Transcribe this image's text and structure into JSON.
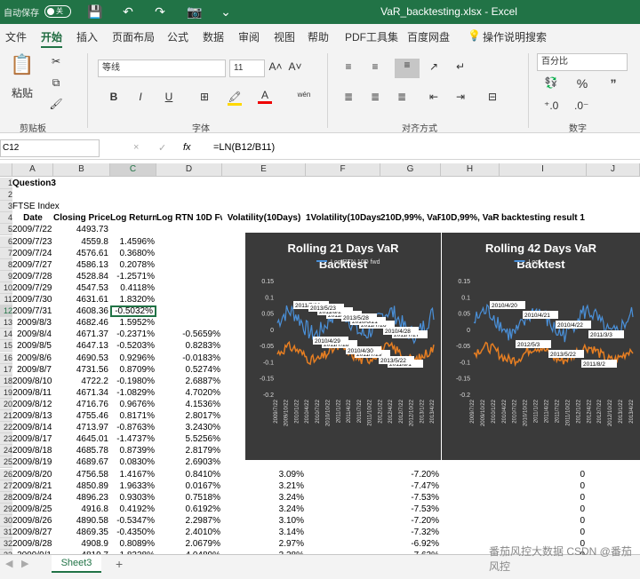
{
  "window": {
    "autosave_label": "自动保存",
    "autosave_state": "关",
    "file_title": "VaR_backtesting.xlsx  -  Excel"
  },
  "menu": [
    "文件",
    "开始",
    "插入",
    "页面布局",
    "公式",
    "数据",
    "审阅",
    "视图",
    "帮助",
    "PDF工具集",
    "百度网盘",
    "操作说明搜索"
  ],
  "ribbon": {
    "paste": "粘贴",
    "clipboard": "剪贴板",
    "font_name": "等线",
    "font_size": "11",
    "font_group": "字体",
    "align_group": "对齐方式",
    "number_format": "百分比",
    "number_group": "数字",
    "bold": "B",
    "italic": "I",
    "underline": "U",
    "font_color": "A",
    "grow_font": "A˄",
    "shrink_font": "A˅",
    "wen": "wén",
    "percent": "%",
    "comma": "”"
  },
  "formula": {
    "name_box": "C12",
    "content": "=LN(B12/B11)",
    "cancel": "×",
    "enter": "✓",
    "fx": "fx"
  },
  "columns": [
    "A",
    "B",
    "C",
    "D",
    "E",
    "F",
    "G",
    "H",
    "I",
    "J"
  ],
  "rows": [
    {
      "n": "1",
      "cells": {
        "A": "Question3"
      }
    },
    {
      "n": "2",
      "cells": {}
    },
    {
      "n": "3",
      "cells": {
        "A": "FTSE Index"
      }
    },
    {
      "n": "4",
      "cells": {
        "A": "Date",
        "B": "Closing Price",
        "C": "Log Return",
        "D": "Log RTN 10D Fwd",
        "E": "Volatility(10Days)",
        "F": "1Volatility(10Days)",
        "G": "210D,99%, VaR1",
        "H": "10D,99%, VaR2",
        "I": "backtesting result 1"
      }
    },
    {
      "n": "5",
      "cells": {
        "A": "2009/7/22",
        "B": "4493.73"
      }
    },
    {
      "n": "6",
      "cells": {
        "A": "2009/7/23",
        "B": "4559.8",
        "C": "1.4596%"
      }
    },
    {
      "n": "7",
      "cells": {
        "A": "2009/7/24",
        "B": "4576.61",
        "C": "0.3680%"
      }
    },
    {
      "n": "8",
      "cells": {
        "A": "2009/7/27",
        "B": "4586.13",
        "C": "0.2078%"
      }
    },
    {
      "n": "9",
      "cells": {
        "A": "2009/7/28",
        "B": "4528.84",
        "C": "-1.2571%"
      }
    },
    {
      "n": "10",
      "cells": {
        "A": "2009/7/29",
        "B": "4547.53",
        "C": "0.4118%"
      }
    },
    {
      "n": "11",
      "cells": {
        "A": "2009/7/30",
        "B": "4631.61",
        "C": "1.8320%"
      }
    },
    {
      "n": "12",
      "cells": {
        "A": "2009/7/31",
        "B": "4608.36",
        "C": "-0.5032%"
      }
    },
    {
      "n": "13",
      "cells": {
        "A": "2009/8/3",
        "B": "4682.46",
        "C": "1.5952%"
      }
    },
    {
      "n": "14",
      "cells": {
        "A": "2009/8/4",
        "B": "4671.37",
        "C": "-0.2371%",
        "D": "-0.5659%"
      }
    },
    {
      "n": "15",
      "cells": {
        "A": "2009/8/5",
        "B": "4647.13",
        "C": "-0.5203%",
        "D": "0.8283%"
      }
    },
    {
      "n": "16",
      "cells": {
        "A": "2009/8/6",
        "B": "4690.53",
        "C": "0.9296%",
        "D": "-0.0183%"
      }
    },
    {
      "n": "17",
      "cells": {
        "A": "2009/8/7",
        "B": "4731.56",
        "C": "0.8709%",
        "D": "0.5274%"
      }
    },
    {
      "n": "18",
      "cells": {
        "A": "2009/8/10",
        "B": "4722.2",
        "C": "-0.1980%",
        "D": "2.6887%"
      }
    },
    {
      "n": "19",
      "cells": {
        "A": "2009/8/11",
        "B": "4671.34",
        "C": "-1.0829%",
        "D": "4.7020%"
      }
    },
    {
      "n": "20",
      "cells": {
        "A": "2009/8/12",
        "B": "4716.76",
        "C": "0.9676%",
        "D": "4.1536%"
      }
    },
    {
      "n": "21",
      "cells": {
        "A": "2009/8/13",
        "B": "4755.46",
        "C": "0.8171%",
        "D": "2.8017%"
      }
    },
    {
      "n": "22",
      "cells": {
        "A": "2009/8/14",
        "B": "4713.97",
        "C": "-0.8763%",
        "D": "3.2430%"
      }
    },
    {
      "n": "23",
      "cells": {
        "A": "2009/8/17",
        "B": "4645.01",
        "C": "-1.4737%",
        "D": "5.5256%"
      }
    },
    {
      "n": "24",
      "cells": {
        "A": "2009/8/18",
        "B": "4685.78",
        "C": "0.8739%",
        "D": "2.8179%"
      }
    },
    {
      "n": "25",
      "cells": {
        "A": "2009/8/19",
        "B": "4689.67",
        "C": "0.0830%",
        "D": "2.6903%"
      }
    },
    {
      "n": "26",
      "cells": {
        "A": "2009/8/20",
        "B": "4756.58",
        "C": "1.4167%",
        "D": "0.8410%",
        "E": "3.09%",
        "G": "-7.20%",
        "I": "0"
      }
    },
    {
      "n": "27",
      "cells": {
        "A": "2009/8/21",
        "B": "4850.89",
        "C": "1.9633%",
        "D": "0.0167%",
        "E": "3.21%",
        "G": "-7.47%",
        "I": "0"
      }
    },
    {
      "n": "28",
      "cells": {
        "A": "2009/8/24",
        "B": "4896.23",
        "C": "0.9303%",
        "D": "0.7518%",
        "E": "3.24%",
        "G": "-7.53%",
        "I": "0"
      }
    },
    {
      "n": "29",
      "cells": {
        "A": "2009/8/25",
        "B": "4916.8",
        "C": "0.4192%",
        "D": "0.6192%",
        "E": "3.24%",
        "G": "-7.53%",
        "I": "0"
      }
    },
    {
      "n": "30",
      "cells": {
        "A": "2009/8/26",
        "B": "4890.58",
        "C": "-0.5347%",
        "D": "2.2987%",
        "E": "3.10%",
        "G": "-7.20%",
        "I": "0"
      }
    },
    {
      "n": "31",
      "cells": {
        "A": "2009/8/27",
        "B": "4869.35",
        "C": "-0.4350%",
        "D": "2.4010%",
        "E": "3.14%",
        "G": "-7.32%",
        "I": "0"
      }
    },
    {
      "n": "32",
      "cells": {
        "A": "2009/8/28",
        "B": "4908.9",
        "C": "0.8089%",
        "D": "2.0679%",
        "E": "2.97%",
        "G": "-6.92%",
        "I": "0"
      }
    },
    {
      "n": "33",
      "cells": {
        "A": "2009/9/1",
        "B": "4819.7",
        "C": "-1.8338%",
        "D": "4.0489%",
        "E": "3.28%",
        "G": "-7.62%",
        "I": "0"
      }
    }
  ],
  "charts": [
    {
      "title_line1": "Rolling 21 Days VaR",
      "title_line2": "Backtest",
      "legend": [
        "Log RTN 10D fwd"
      ],
      "y_ticks": [
        "0.15",
        "0.1",
        "0.05",
        "0",
        "-0.05",
        "-0.1",
        "-0.15",
        "-0.2"
      ],
      "x_ticks": [
        "2009/7/22",
        "2009/10/22",
        "2010/1/22",
        "2010/4/22",
        "2010/7/22",
        "2010/10/22",
        "2011/1/22",
        "2011/4/22",
        "2011/7/22",
        "2011/10/22",
        "2012/1/22",
        "2012/4/22",
        "2012/7/22",
        "2012/10/22",
        "2013/1/22",
        "2013/4/22"
      ],
      "labels": [
        "2011/7/22",
        "2011/7/25",
        "2011/7/26",
        "2011/7/27",
        "2011/7/28",
        "2011/7/29",
        "2011/8/1",
        "2011/8/2",
        "2010/6/21",
        "2010/4/28",
        "2010/4/29",
        "2010/4/30",
        "2013/5/22",
        "2013/5/23",
        "2013/5/28"
      ]
    },
    {
      "title_line1": "Rolling 42 Days VaR",
      "title_line2": "Backtest",
      "legend": [
        "Log"
      ],
      "y_ticks": [
        "0.15",
        "0.1",
        "0.05",
        "0",
        "-0.05",
        "-0.1",
        "-0.15",
        "-0.2"
      ],
      "x_ticks": [
        "2009/7/22",
        "2009/10/22",
        "2010/1/22",
        "2010/4/22",
        "2010/7/22",
        "2010/10/22",
        "2011/1/22",
        "2011/4/22",
        "2011/7/22",
        "2011/10/22",
        "2012/1/22",
        "2012/4/22",
        "2012/7/22",
        "2012/10/22",
        "2013/1/22",
        "2013/4/22"
      ],
      "labels": [
        "2010/4/20",
        "2010/4/21",
        "2010/4/22",
        "2011/3/3",
        "2012/5/3",
        "2013/5/22",
        "2011/8/2"
      ]
    }
  ],
  "colors": {
    "title_green": "#217346",
    "series_blue": "#4a90d9",
    "series_orange": "#e67e22",
    "chart_bg": "#3a3a3a"
  },
  "sheet": {
    "tab": "Sheet3",
    "add": "+"
  },
  "watermark": "番茄风控大数据  CSDN @番茄风控"
}
